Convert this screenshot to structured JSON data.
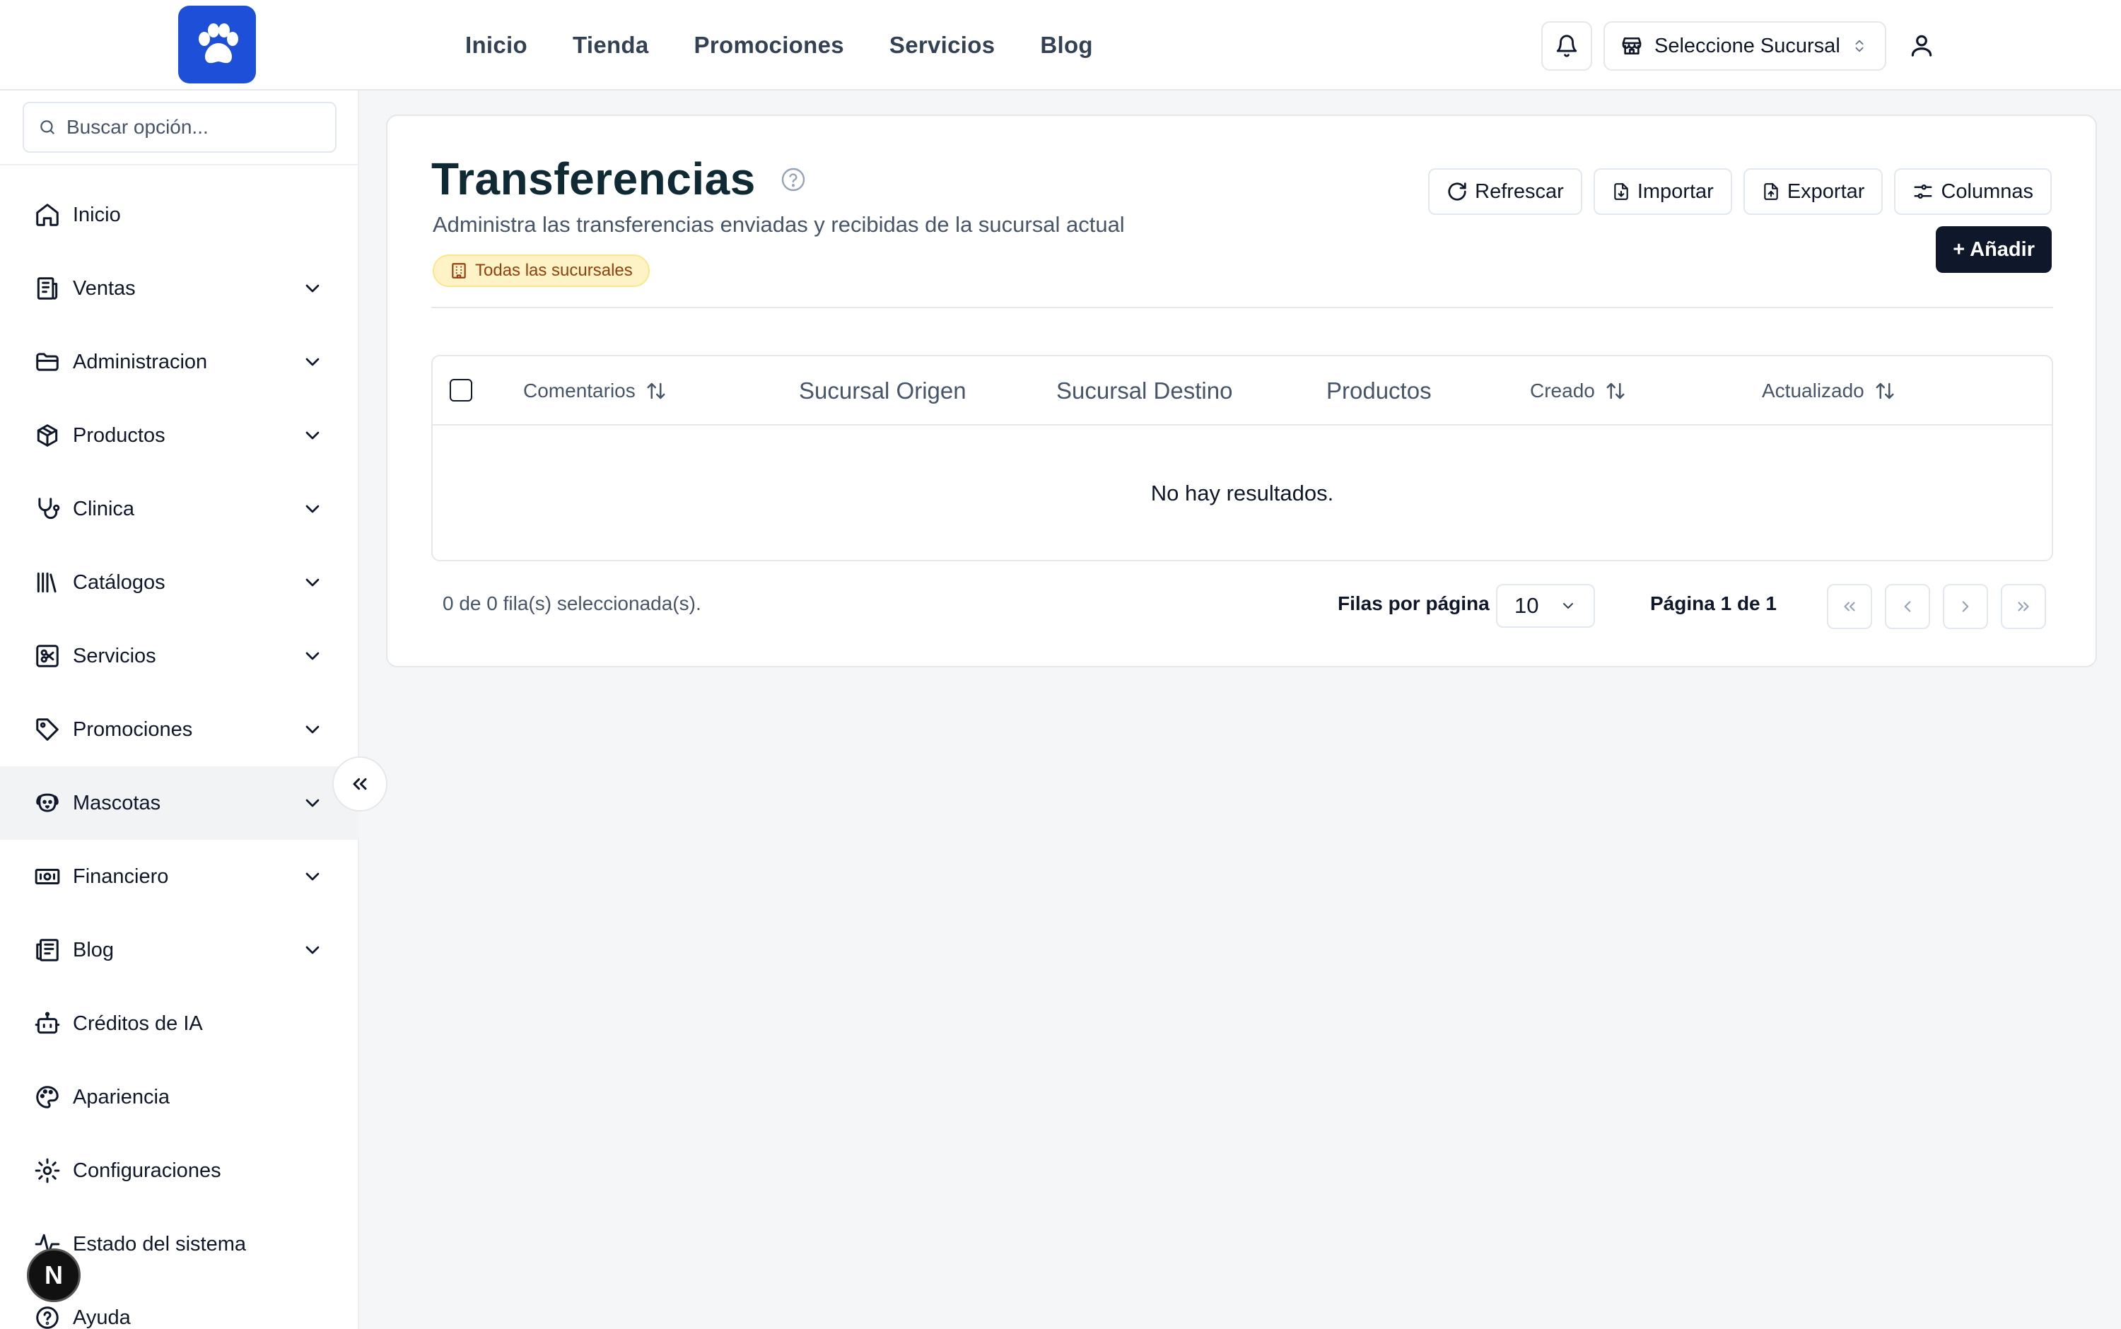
{
  "topbar": {
    "nav": [
      "Inicio",
      "Tienda",
      "Promociones",
      "Servicios",
      "Blog"
    ],
    "branch_select": "Seleccione Sucursal"
  },
  "sidebar": {
    "search_placeholder": "Buscar opción...",
    "items": [
      {
        "label": "Inicio",
        "icon": "home-icon",
        "expandable": false
      },
      {
        "label": "Ventas",
        "icon": "receipt-icon",
        "expandable": true
      },
      {
        "label": "Administracion",
        "icon": "folder-icon",
        "expandable": true
      },
      {
        "label": "Productos",
        "icon": "package-icon",
        "expandable": true
      },
      {
        "label": "Clinica",
        "icon": "stethoscope-icon",
        "expandable": true
      },
      {
        "label": "Catálogos",
        "icon": "library-icon",
        "expandable": true
      },
      {
        "label": "Servicios",
        "icon": "scissors-icon",
        "expandable": true
      },
      {
        "label": "Promociones",
        "icon": "tag-icon",
        "expandable": true
      },
      {
        "label": "Mascotas",
        "icon": "dog-icon",
        "expandable": true,
        "active": true
      },
      {
        "label": "Financiero",
        "icon": "banknote-icon",
        "expandable": true
      },
      {
        "label": "Blog",
        "icon": "newspaper-icon",
        "expandable": true
      },
      {
        "label": "Créditos de IA",
        "icon": "bot-icon",
        "expandable": false
      },
      {
        "label": "Apariencia",
        "icon": "palette-icon",
        "expandable": false
      },
      {
        "label": "Configuraciones",
        "icon": "gear-icon",
        "expandable": false
      },
      {
        "label": "Estado del sistema",
        "icon": "activity-icon",
        "expandable": false
      },
      {
        "label": "Ayuda",
        "icon": "help-circle-icon",
        "expandable": false
      }
    ],
    "badge": "N"
  },
  "page": {
    "title": "Transferencias",
    "subtitle": "Administra las transferencias enviadas y recibidas de la sucursal actual",
    "scope_badge": "Todas las sucursales",
    "actions": {
      "refresh": "Refrescar",
      "import": "Importar",
      "export": "Exportar",
      "columns": "Columnas",
      "add": "+ Añadir"
    }
  },
  "table": {
    "columns": [
      "Comentarios",
      "Sucursal Origen",
      "Sucursal Destino",
      "Productos",
      "Creado",
      "Actualizado"
    ],
    "empty_text": "No hay resultados."
  },
  "footer": {
    "selected": "0 de 0 fila(s) seleccionada(s).",
    "rows_per_page_label": "Filas por página",
    "rows_per_page_value": "10",
    "page_info": "Página 1 de 1"
  },
  "colors": {
    "brand": "#1d4fd8",
    "primary_button": "#0f172a",
    "badge_bg": "#fef3c7",
    "badge_text": "#92400e"
  }
}
